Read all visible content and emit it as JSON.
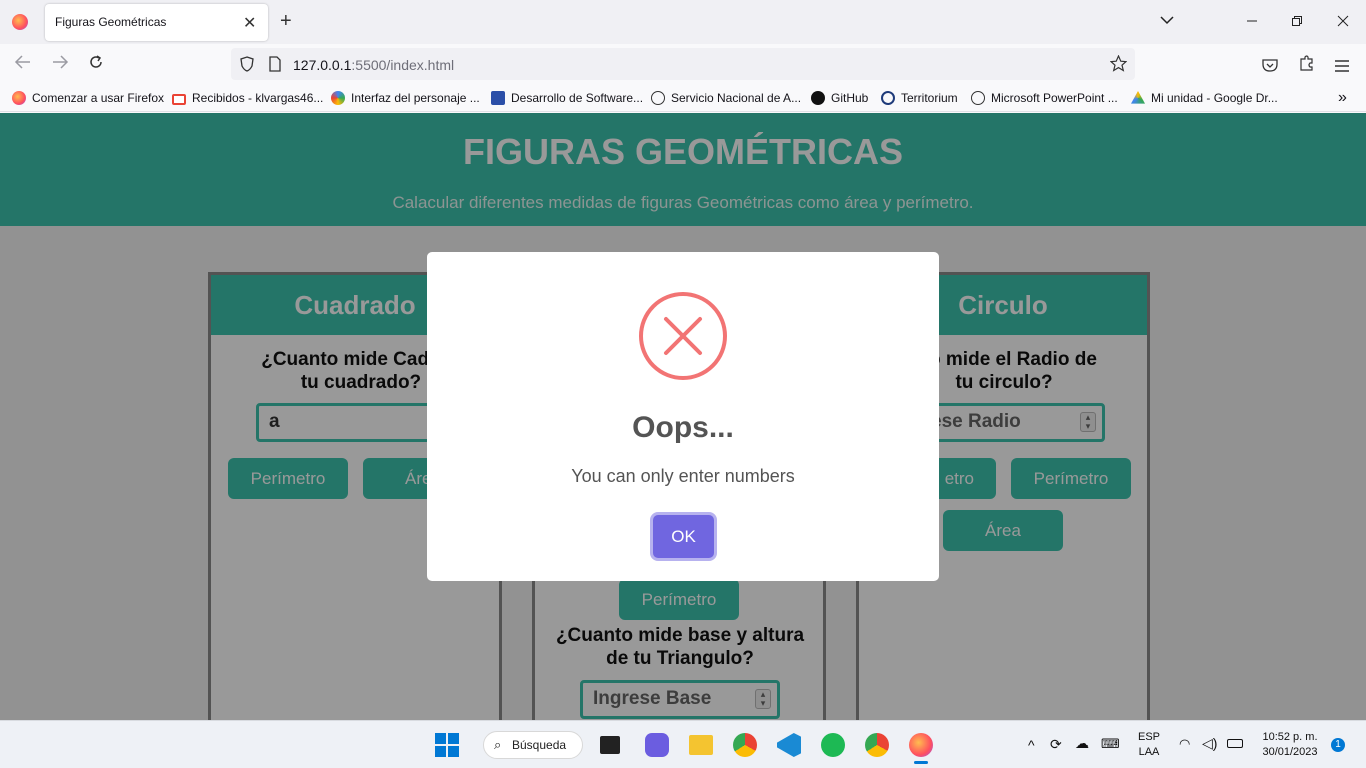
{
  "browser": {
    "tab_title": "Figuras Geométricas",
    "tab_close": "✕",
    "new_tab": "+",
    "url_host": "127.0.0.1",
    "url_rest": ":5500/index.html",
    "bookmarks": [
      "Comenzar a usar Firefox",
      "Recibidos - klvargas46...",
      "Interfaz del personaje ...",
      "Desarrollo de Software...",
      "Servicio Nacional de A...",
      "GitHub",
      "Territorium",
      "Microsoft PowerPoint ...",
      "Mi unidad - Google Dr..."
    ]
  },
  "page": {
    "title": "FIGURAS GEOMÉTRICAS",
    "subtitle": "Calacular diferentes medidas de figuras Geométricas como área y perímetro.",
    "square": {
      "header": "Cuadrado",
      "question": "¿Cuanto mide Cada la tu cuadrado?",
      "question_line1": "¿Cuanto mide Cada la",
      "question_line2": "tu cuadrado?",
      "input_value": "a",
      "btn_perimeter": "Perímetro",
      "btn_area": "Área"
    },
    "triangle": {
      "btn_perimeter": "Perímetro",
      "question_line1": "¿Cuanto mide base y altura",
      "question_line2": "de tu Triangulo?",
      "input_placeholder": "Ingrese Base"
    },
    "circle": {
      "header": "Circulo",
      "question_line1": "nto mide el Radio de",
      "question_line2": "tu circulo?",
      "input_placeholder": "grese Radio",
      "btn_partial": "etro",
      "btn_perimeter": "Perímetro",
      "btn_area": "Área"
    }
  },
  "modal": {
    "title": "Oops...",
    "message": "You can only enter numbers",
    "ok_label": "OK"
  },
  "taskbar": {
    "search_label": "Búsqueda",
    "lang_top": "ESP",
    "lang_bottom": "LAA",
    "time": "10:52 p. m.",
    "date": "30/01/2023",
    "notification_count": "1"
  },
  "colors": {
    "accent": "#3cc4ae",
    "ok_button": "#7066e0",
    "error_icon": "#f27474"
  }
}
